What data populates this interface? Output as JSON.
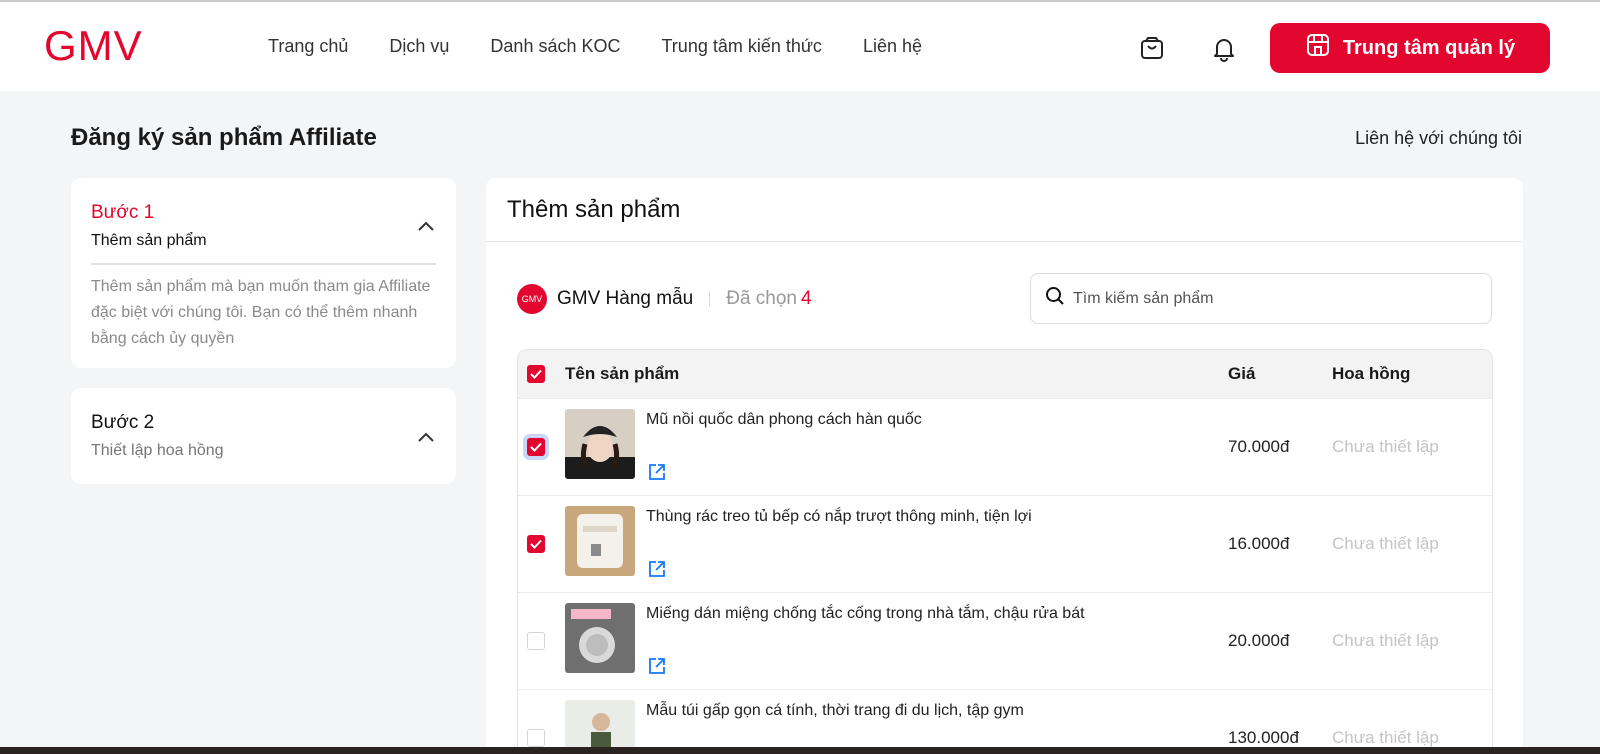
{
  "brand": {
    "logo_text": "GMV",
    "accent": "#e3072f"
  },
  "nav": {
    "items": [
      "Trang chủ",
      "Dịch vụ",
      "Danh sách KOC",
      "Trung tâm kiến thức",
      "Liên hệ"
    ]
  },
  "header": {
    "cart_icon": "shopping-bag-icon",
    "bell_icon": "bell-icon",
    "manager_button": "Trung tâm quản lý"
  },
  "page": {
    "title": "Đăng ký sản phẩm Affiliate",
    "contact_link": "Liên hệ với chúng tôi"
  },
  "steps": [
    {
      "label": "Bước 1",
      "subtitle": "Thêm sản phẩm",
      "description": "Thêm sản phẩm mà bạn muốn tham gia Affiliate đặc biệt với chúng tôi. Bạn có thể thêm nhanh bằng cách ủy quyền",
      "expanded": true
    },
    {
      "label": "Bước 2",
      "subtitle": "Thiết lập hoa hồng",
      "expanded": false
    }
  ],
  "main": {
    "title": "Thêm sản phẩm",
    "shop": {
      "logo_text": "GMV",
      "name": "GMV Hàng mẫu",
      "selected_label": "Đã chọn",
      "selected_count": "4"
    },
    "search": {
      "placeholder": "Tìm kiếm sản phẩm"
    },
    "table": {
      "headers": {
        "name": "Tên sản phẩm",
        "price": "Giá",
        "commission": "Hoa hồng"
      },
      "rows": [
        {
          "name": "Mũ nồi quốc dân phong cách hàn quốc",
          "price": "70.000đ",
          "commission": "Chưa thiết lập",
          "checked": true
        },
        {
          "name": "Thùng rác treo tủ bếp có nắp trượt thông minh, tiện lợi",
          "price": "16.000đ",
          "commission": "Chưa thiết lập",
          "checked": true
        },
        {
          "name": "Miếng dán miệng chống tắc cống trong nhà tắm, chậu rửa bát",
          "price": "20.000đ",
          "commission": "Chưa thiết lập",
          "checked": false
        },
        {
          "name": "Mẫu túi gấp gọn cá tính, thời trang đi du lịch, tập gym",
          "price": "130.000đ",
          "commission": "Chưa thiết lập",
          "checked": false
        }
      ]
    }
  }
}
